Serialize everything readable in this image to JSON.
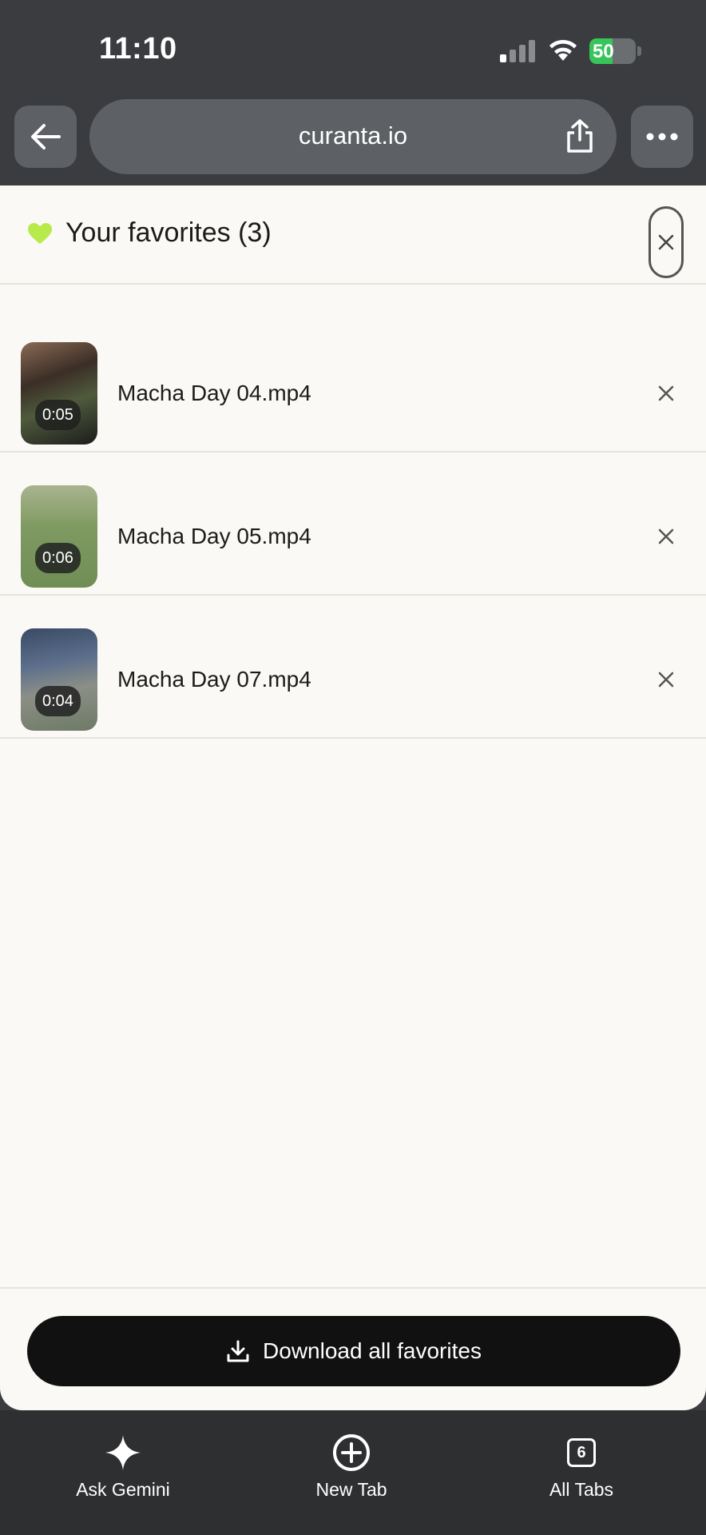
{
  "status_bar": {
    "time": "11:10",
    "battery_percent": "50",
    "battery_level": 0.5
  },
  "browser": {
    "url": "curanta.io"
  },
  "favorites": {
    "title": "Your favorites (3)",
    "items": [
      {
        "name": "Macha Day 04.mp4",
        "duration": "0:05"
      },
      {
        "name": "Macha Day 05.mp4",
        "duration": "0:06"
      },
      {
        "name": "Macha Day 07.mp4",
        "duration": "0:04"
      }
    ],
    "download_label": "Download all favorites"
  },
  "bottom_nav": {
    "ask_gemini": "Ask Gemini",
    "new_tab": "New Tab",
    "all_tabs": "All Tabs",
    "tab_count": "6"
  },
  "colors": {
    "heart": "#b7ea4a",
    "battery_fill": "#37c55a",
    "download_bg": "#111111"
  },
  "icons": [
    "back-arrow-icon",
    "share-icon",
    "more-icon",
    "heart-icon",
    "close-icon",
    "download-icon",
    "sparkle-icon",
    "plus-circle-icon"
  ]
}
